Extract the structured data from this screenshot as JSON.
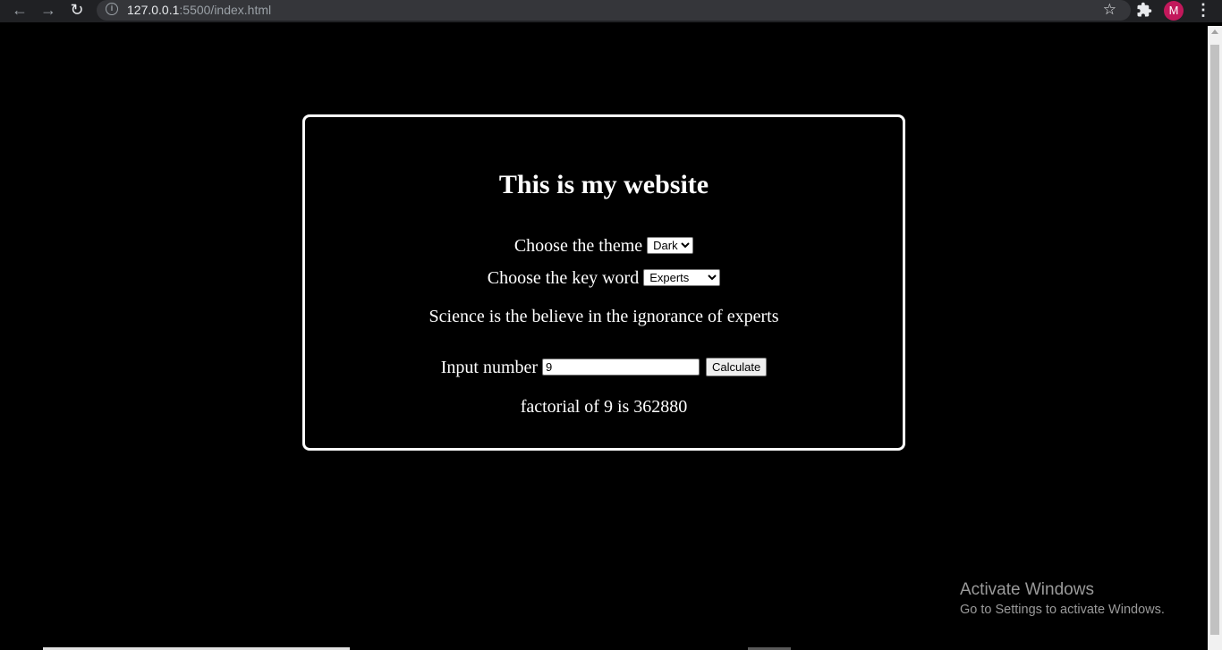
{
  "browser": {
    "back_icon": "arrow-left-icon",
    "forward_icon": "arrow-right-icon",
    "reload_icon": "reload-icon",
    "url_host": "127.0.0.1",
    "url_rest": ":5500/index.html",
    "avatar_letter": "M"
  },
  "page": {
    "title": "This is my website",
    "theme_label": "Choose the theme",
    "theme_selected": "Dark",
    "keyword_label": "Choose the key word",
    "keyword_selected": "Experts",
    "quote": "Science is the believe in the ignorance of experts",
    "input_label": "Input number",
    "input_value": "9",
    "calculate_label": "Calculate",
    "result": "factorial of 9 is 362880"
  },
  "watermark": {
    "line1": "Activate Windows",
    "line2": "Go to Settings to activate Windows."
  },
  "colors": {
    "background": "#000000",
    "text": "#ffffff",
    "card_border": "#ffffff",
    "avatar": "#c2185b"
  }
}
